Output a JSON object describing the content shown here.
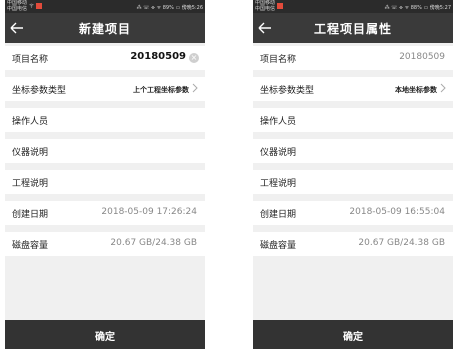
{
  "left": {
    "status": {
      "carrier1": "中国移动",
      "carrier2": "中国电信",
      "right": "⁂ ☏ ⌯ ᯤ 89% ▭ 傍晚5:26"
    },
    "title": "新建项目",
    "rows": [
      {
        "label": "项目名称",
        "value": "20180509"
      },
      {
        "label": "坐标参数类型",
        "value": "上个工程坐标参数"
      },
      {
        "label": "操作人员",
        "value": ""
      },
      {
        "label": "仪器说明",
        "value": ""
      },
      {
        "label": "工程说明",
        "value": ""
      },
      {
        "label": "创建日期",
        "value": "2018-05-09 17:26:24"
      },
      {
        "label": "磁盘容量",
        "value": "20.67 GB/24.38 GB"
      }
    ],
    "confirm": "确定"
  },
  "right": {
    "status": {
      "carrier1": "中国移动",
      "carrier2": "中国电信",
      "right": "⁂ ☏ ⌯ ᯤ 88% ▭ 傍晚5:27"
    },
    "title": "工程项目属性",
    "rows": [
      {
        "label": "项目名称",
        "value": "20180509"
      },
      {
        "label": "坐标参数类型",
        "value": "本地坐标参数"
      },
      {
        "label": "操作人员",
        "value": ""
      },
      {
        "label": "仪器说明",
        "value": ""
      },
      {
        "label": "工程说明",
        "value": ""
      },
      {
        "label": "创建日期",
        "value": "2018-05-09 16:55:04"
      },
      {
        "label": "磁盘容量",
        "value": "20.67 GB/24.38 GB"
      }
    ],
    "confirm": "确定"
  },
  "icons": {
    "back": "arrow-left-icon",
    "clear": "clear-circle-icon",
    "chevron": "chevron-right-icon",
    "signal": "signal-icon",
    "wifi": "wifi-icon",
    "battery": "battery-icon"
  },
  "colors": {
    "titlebar": "#3a3a3a",
    "statusbar": "#2b2b2b",
    "bottombar": "#333333",
    "background": "#f0f0f0",
    "value_muted": "#888888"
  }
}
